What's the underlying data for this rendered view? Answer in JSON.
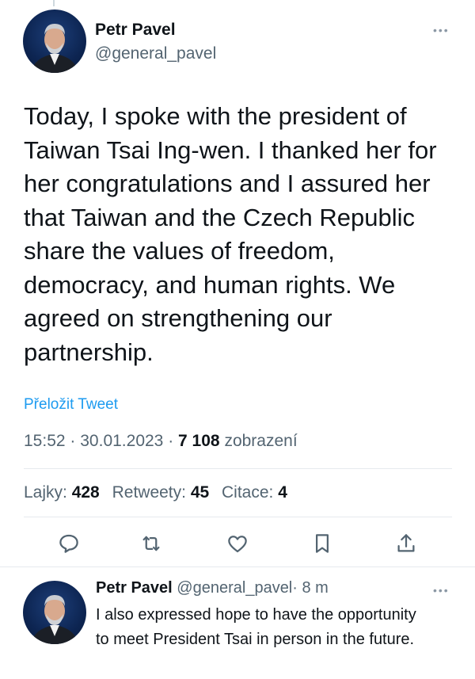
{
  "tweet": {
    "author_name": "Petr Pavel",
    "author_handle": "@general_pavel",
    "more_icon": "ellipsis-icon",
    "text": "Today, I spoke with the president of Taiwan Tsai Ing-wen. I thanked her for her congratulations and I assured her that Taiwan and the Czech Republic share the values of freedom, democracy, and human rights. We agreed on strengthening our partnership.",
    "translate_label": "Přeložit Tweet",
    "time": "15:52",
    "date": "30.01.2023",
    "views_count": "7 108",
    "views_label": "zobrazení",
    "separator": "·",
    "stats": {
      "likes_label": "Lajky:",
      "likes_count": "428",
      "retweets_label": "Retweety:",
      "retweets_count": "45",
      "quotes_label": "Citace:",
      "quotes_count": "4"
    },
    "actions": [
      "reply-icon",
      "retweet-icon",
      "like-icon",
      "bookmark-icon",
      "share-icon"
    ]
  },
  "reply": {
    "author_name": "Petr Pavel",
    "author_handle": "@general_pavel",
    "separator": "·",
    "age": "8 m",
    "text": "I also expressed hope to have the opportunity to meet President Tsai in person in the future."
  },
  "colors": {
    "text": "#0f1419",
    "secondary": "#536471",
    "link": "#1d9bf0",
    "divider": "#e6eaee"
  }
}
